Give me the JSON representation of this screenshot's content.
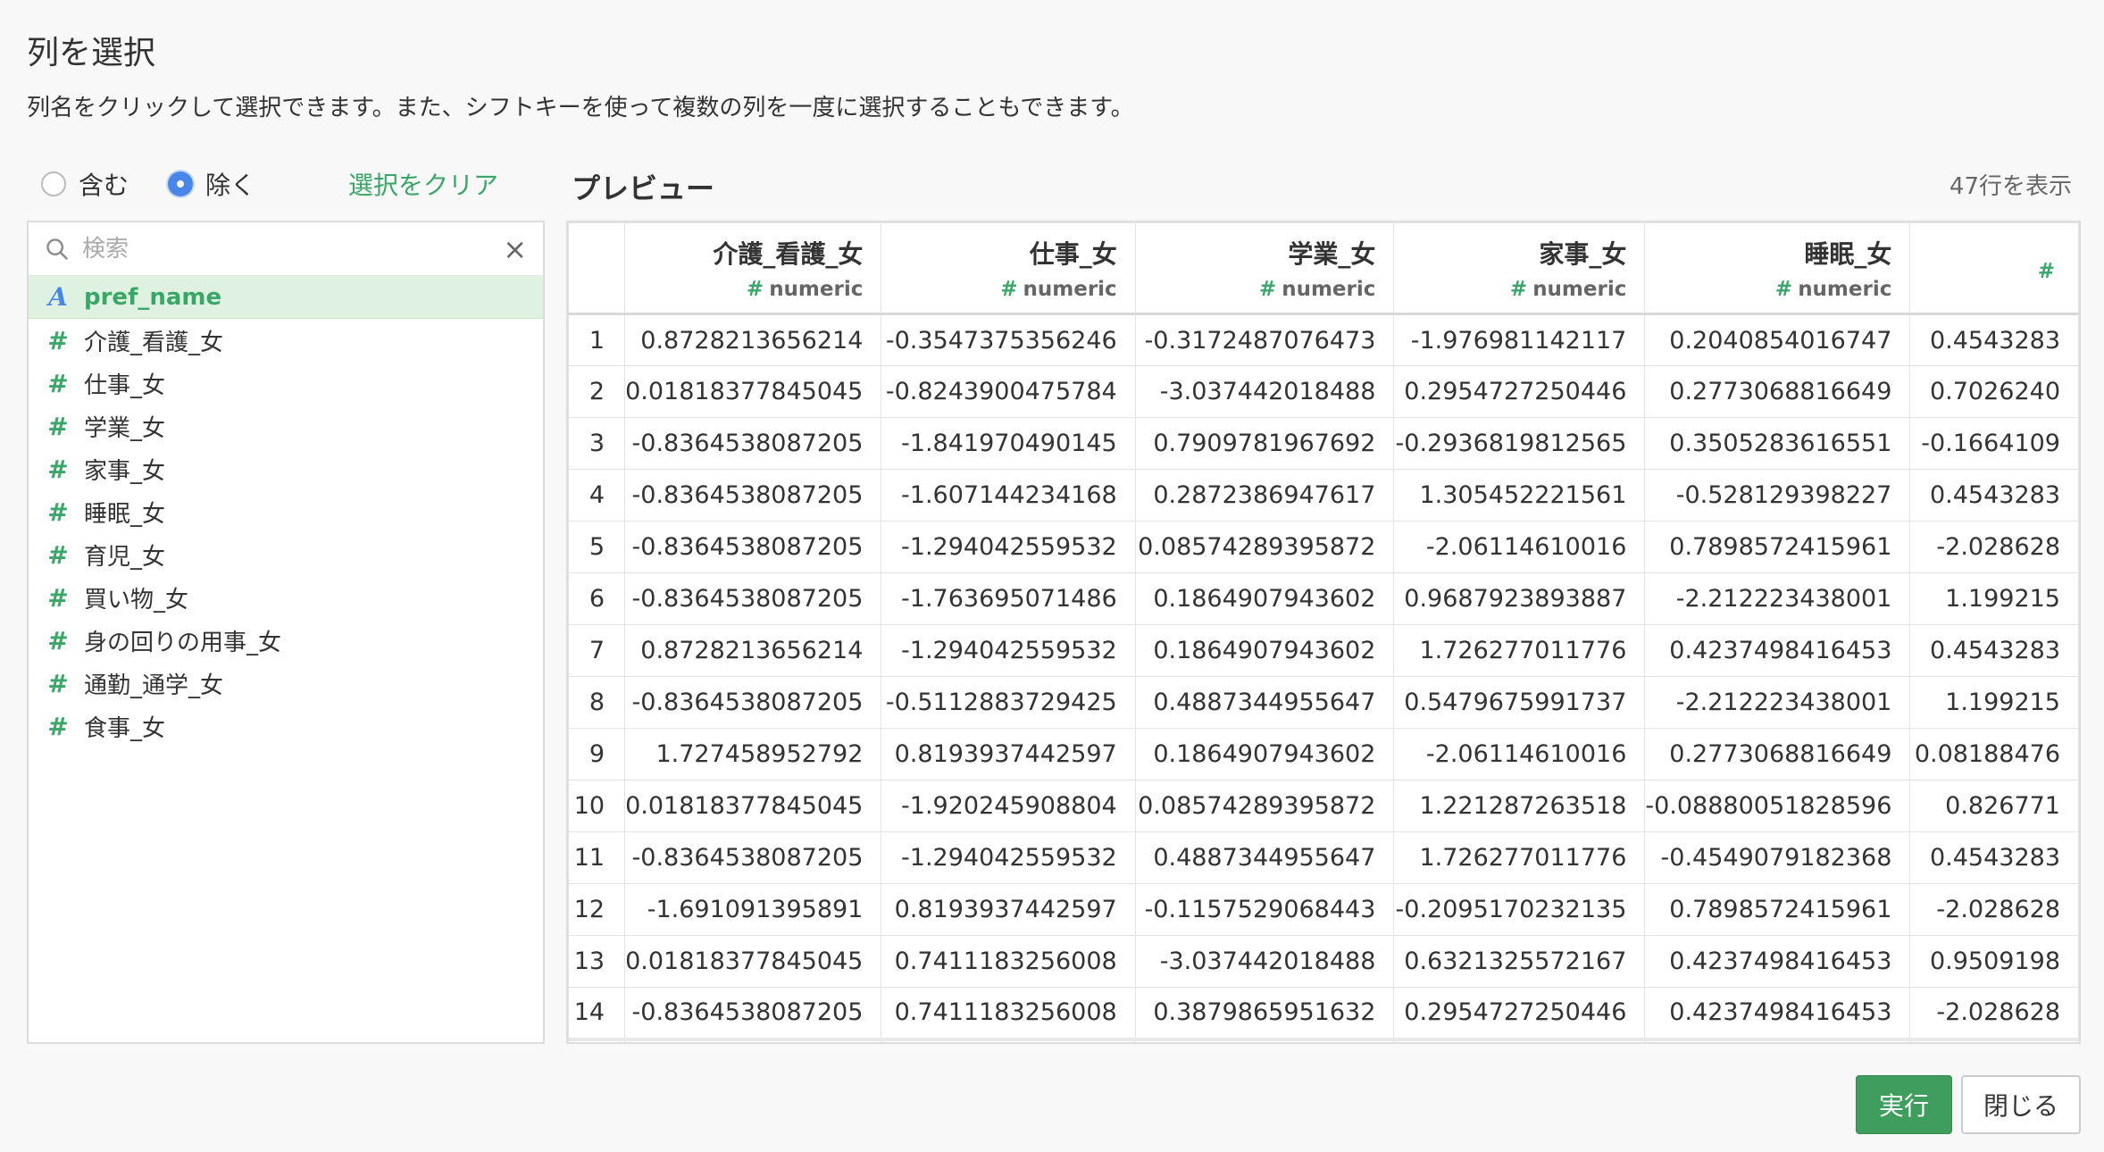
{
  "dialog": {
    "title": "列を選択",
    "description": "列名をクリックして選択できます。また、シフトキーを使って複数の列を一度に選択することもできます。"
  },
  "mode": {
    "include_label": "含む",
    "exclude_label": "除く",
    "selected": "exclude",
    "clear_label": "選択をクリア"
  },
  "search": {
    "placeholder": "検索",
    "value": ""
  },
  "columns": [
    {
      "type": "A",
      "name": "pref_name",
      "selected": true
    },
    {
      "type": "#",
      "name": "介護_看護_女",
      "selected": false
    },
    {
      "type": "#",
      "name": "仕事_女",
      "selected": false
    },
    {
      "type": "#",
      "name": "学業_女",
      "selected": false
    },
    {
      "type": "#",
      "name": "家事_女",
      "selected": false
    },
    {
      "type": "#",
      "name": "睡眠_女",
      "selected": false
    },
    {
      "type": "#",
      "name": "育児_女",
      "selected": false
    },
    {
      "type": "#",
      "name": "買い物_女",
      "selected": false
    },
    {
      "type": "#",
      "name": "身の回りの用事_女",
      "selected": false
    },
    {
      "type": "#",
      "name": "通勤_通学_女",
      "selected": false
    },
    {
      "type": "#",
      "name": "食事_女",
      "selected": false
    }
  ],
  "preview": {
    "title": "プレビュー",
    "row_count": "47行を表示",
    "headers": [
      {
        "name": "介護_看護_女",
        "type": "numeric"
      },
      {
        "name": "仕事_女",
        "type": "numeric"
      },
      {
        "name": "学業_女",
        "type": "numeric"
      },
      {
        "name": "家事_女",
        "type": "numeric"
      },
      {
        "name": "睡眠_女",
        "type": "numeric"
      },
      {
        "name": "",
        "type": ""
      }
    ],
    "rows": [
      [
        "1",
        "0.8728213656214",
        "-0.3547375356246",
        "-0.3172487076473",
        "-1.976981142117",
        "0.2040854016747",
        "0.4543283"
      ],
      [
        "2",
        "0.01818377845045",
        "-0.8243900475784",
        "-3.037442018488",
        "0.2954727250446",
        "0.2773068816649",
        "0.7026240"
      ],
      [
        "3",
        "-0.8364538087205",
        "-1.841970490145",
        "0.7909781967692",
        "-0.2936819812565",
        "0.3505283616551",
        "-0.1664109"
      ],
      [
        "4",
        "-0.8364538087205",
        "-1.607144234168",
        "0.2872386947617",
        "1.305452221561",
        "-0.528129398227",
        "0.4543283"
      ],
      [
        "5",
        "-0.8364538087205",
        "-1.294042559532",
        "0.08574289395872",
        "-2.06114610016",
        "0.7898572415961",
        "-2.028628"
      ],
      [
        "6",
        "-0.8364538087205",
        "-1.763695071486",
        "0.1864907943602",
        "0.9687923893887",
        "-2.212223438001",
        "1.199215"
      ],
      [
        "7",
        "0.8728213656214",
        "-1.294042559532",
        "0.1864907943602",
        "1.726277011776",
        "0.4237498416453",
        "0.4543283"
      ],
      [
        "8",
        "-0.8364538087205",
        "-0.5112883729425",
        "0.4887344955647",
        "0.5479675991737",
        "-2.212223438001",
        "1.199215"
      ],
      [
        "9",
        "1.727458952792",
        "0.8193937442597",
        "0.1864907943602",
        "-2.06114610016",
        "0.2773068816649",
        "0.08188476"
      ],
      [
        "10",
        "0.01818377845045",
        "-1.920245908804",
        "0.08574289395872",
        "1.221287263518",
        "-0.08880051828596",
        "0.826771"
      ],
      [
        "11",
        "-0.8364538087205",
        "-1.294042559532",
        "0.4887344955647",
        "1.726277011776",
        "-0.4549079182368",
        "0.4543283"
      ],
      [
        "12",
        "-1.691091395891",
        "0.8193937442597",
        "-0.1157529068443",
        "-0.2095170232135",
        "0.7898572415961",
        "-2.028628"
      ],
      [
        "13",
        "0.01818377845045",
        "0.7411183256008",
        "-3.037442018488",
        "0.6321325572167",
        "0.4237498416453",
        "0.9509198"
      ],
      [
        "14",
        "-0.8364538087205",
        "0.7411183256008",
        "0.3879865951632",
        "0.2954727250446",
        "0.4237498416453",
        "-2.028628"
      ]
    ]
  },
  "buttons": {
    "run_label": "実行",
    "close_label": "閉じる"
  },
  "colors": {
    "accent_green": "#3aa668",
    "run_button": "#3f9e5e",
    "radio_blue": "#4a86e8",
    "selected_row_bg": "#dff2e2"
  }
}
